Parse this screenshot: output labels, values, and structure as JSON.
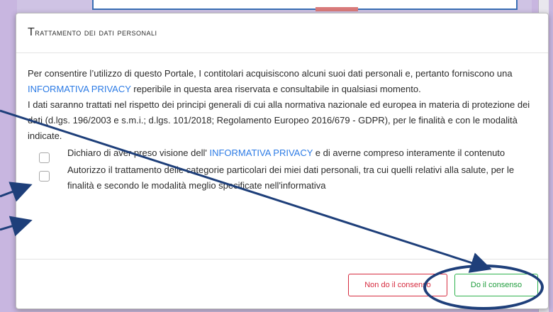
{
  "modal": {
    "title": "Trattamento dei dati personali",
    "intro_part1": "Per consentire l’utilizzo di questo Portale, I contitolari acquisiscono alcuni suoi dati personali e, pertanto forniscono una ",
    "intro_link": "INFORMATIVA PRIVACY",
    "intro_part2": " reperibile in questa area riservata e consultabile in qualsiasi momento.",
    "paragraph2": "I dati saranno trattati nel rispetto dei principi generali di cui alla normativa nazionale ed europea in materia di protezione dei dati (d.lgs. 196/2003 e s.m.i.; d.lgs. 101/2018; Regolamento Europeo 2016/679 - GDPR), per le finalità e con le modalità indicate.",
    "check1_part1": "Dichiaro di aver preso visione dell' ",
    "check1_link": "INFORMATIVA PRIVACY",
    "check1_part2": " e di averne compreso interamente il contenuto",
    "check2": "Autorizzo il trattamento delle categorie particolari dei miei dati personali, tra cui quelli relativi alla salute, per le finalità e secondo le modalità meglio specificate nell'informativa",
    "deny_label": "Non do il consenso",
    "consent_label": "Do il consenso"
  },
  "colors": {
    "link": "#2c7be5",
    "deny": "#d62b3f",
    "consent": "#1f9d3d",
    "annotation": "#1e3f7a"
  }
}
